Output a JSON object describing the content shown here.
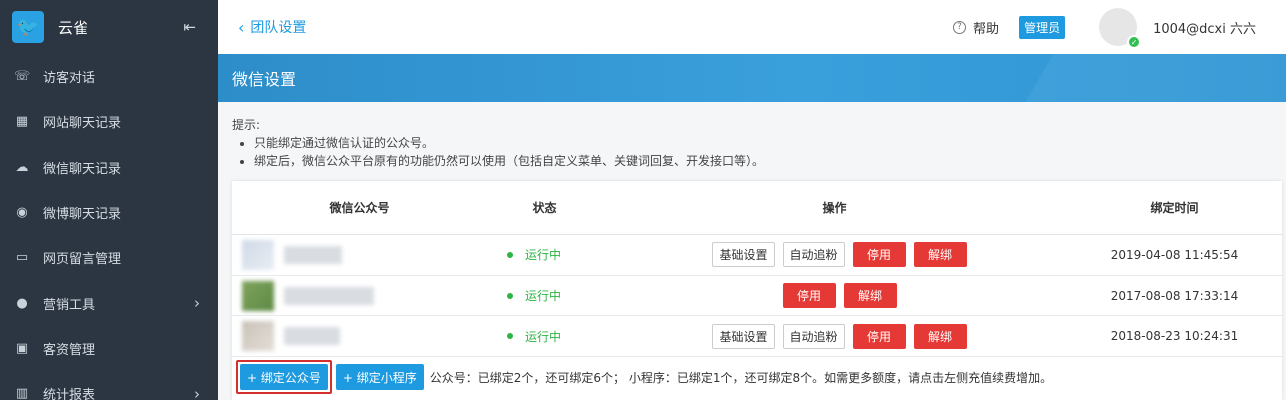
{
  "brand": {
    "name": "云雀"
  },
  "sidebar": {
    "items": [
      {
        "label": "访客对话",
        "icon": "phone-icon",
        "glyph": "☏"
      },
      {
        "label": "网站聊天记录",
        "icon": "calendar-icon",
        "glyph": "▦"
      },
      {
        "label": "微信聊天记录",
        "icon": "wechat-icon",
        "glyph": "☁"
      },
      {
        "label": "微博聊天记录",
        "icon": "weibo-icon",
        "glyph": "◉"
      },
      {
        "label": "网页留言管理",
        "icon": "message-icon",
        "glyph": "▭"
      },
      {
        "label": "营销工具",
        "icon": "bulb-icon",
        "glyph": "●",
        "arrow": "›"
      },
      {
        "label": "客资管理",
        "icon": "contact-icon",
        "glyph": "▣"
      },
      {
        "label": "统计报表",
        "icon": "chart-icon",
        "glyph": "▥",
        "arrow": "›"
      }
    ]
  },
  "header": {
    "back_label": "团队设置",
    "help_label": "帮助",
    "admin_label": "管理员",
    "username": "1004@dcxi 六六"
  },
  "banner": {
    "title": "微信设置"
  },
  "tips": {
    "heading": "提示:",
    "items": [
      "只能绑定通过微信认证的公众号。",
      "绑定后，微信公众平台原有的功能仍然可以使用（包括自定义菜单、关键词回复、开发接口等）。"
    ]
  },
  "table": {
    "headers": {
      "account": "微信公众号",
      "status": "状态",
      "ops": "操作",
      "time": "绑定时间"
    },
    "rows": [
      {
        "status": "运行中",
        "time": "2019-04-08 11:45:54",
        "btn_basic": "基础设置",
        "btn_fans": "自动追粉",
        "btn_stop": "停用",
        "btn_unbind": "解绑"
      },
      {
        "status": "运行中",
        "time": "2017-08-08 17:33:14",
        "btn_stop": "停用",
        "btn_unbind": "解绑"
      },
      {
        "status": "运行中",
        "time": "2018-08-23 10:24:31",
        "btn_basic": "基础设置",
        "btn_fans": "自动追粉",
        "btn_stop": "停用",
        "btn_unbind": "解绑"
      }
    ]
  },
  "footer": {
    "bind_account": "+ 绑定公众号",
    "bind_miniapp": "+ 绑定小程序",
    "note": "公众号：已绑定2个，还可绑定6个； 小程序：已绑定1个，还可绑定8个。如需更多额度，请点击左侧充值续费增加。"
  },
  "colors": {
    "accent": "#1e9ae0",
    "sidebar": "#2b3642",
    "danger": "#e53935",
    "success": "#2fb344"
  }
}
